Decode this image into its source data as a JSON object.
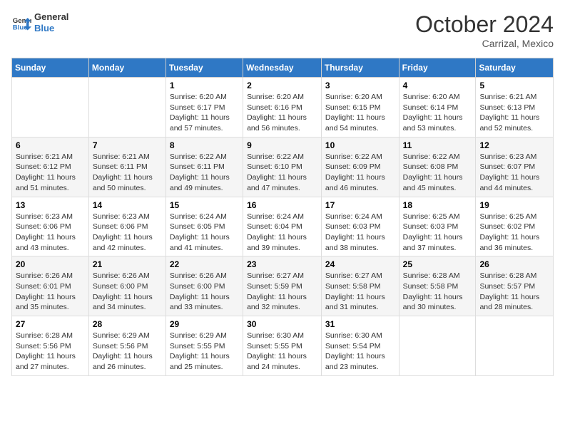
{
  "logo": {
    "line1": "General",
    "line2": "Blue"
  },
  "title": "October 2024",
  "location": "Carrizal, Mexico",
  "days_header": [
    "Sunday",
    "Monday",
    "Tuesday",
    "Wednesday",
    "Thursday",
    "Friday",
    "Saturday"
  ],
  "weeks": [
    [
      {
        "num": "",
        "text": ""
      },
      {
        "num": "",
        "text": ""
      },
      {
        "num": "1",
        "text": "Sunrise: 6:20 AM\nSunset: 6:17 PM\nDaylight: 11 hours and 57 minutes."
      },
      {
        "num": "2",
        "text": "Sunrise: 6:20 AM\nSunset: 6:16 PM\nDaylight: 11 hours and 56 minutes."
      },
      {
        "num": "3",
        "text": "Sunrise: 6:20 AM\nSunset: 6:15 PM\nDaylight: 11 hours and 54 minutes."
      },
      {
        "num": "4",
        "text": "Sunrise: 6:20 AM\nSunset: 6:14 PM\nDaylight: 11 hours and 53 minutes."
      },
      {
        "num": "5",
        "text": "Sunrise: 6:21 AM\nSunset: 6:13 PM\nDaylight: 11 hours and 52 minutes."
      }
    ],
    [
      {
        "num": "6",
        "text": "Sunrise: 6:21 AM\nSunset: 6:12 PM\nDaylight: 11 hours and 51 minutes."
      },
      {
        "num": "7",
        "text": "Sunrise: 6:21 AM\nSunset: 6:11 PM\nDaylight: 11 hours and 50 minutes."
      },
      {
        "num": "8",
        "text": "Sunrise: 6:22 AM\nSunset: 6:11 PM\nDaylight: 11 hours and 49 minutes."
      },
      {
        "num": "9",
        "text": "Sunrise: 6:22 AM\nSunset: 6:10 PM\nDaylight: 11 hours and 47 minutes."
      },
      {
        "num": "10",
        "text": "Sunrise: 6:22 AM\nSunset: 6:09 PM\nDaylight: 11 hours and 46 minutes."
      },
      {
        "num": "11",
        "text": "Sunrise: 6:22 AM\nSunset: 6:08 PM\nDaylight: 11 hours and 45 minutes."
      },
      {
        "num": "12",
        "text": "Sunrise: 6:23 AM\nSunset: 6:07 PM\nDaylight: 11 hours and 44 minutes."
      }
    ],
    [
      {
        "num": "13",
        "text": "Sunrise: 6:23 AM\nSunset: 6:06 PM\nDaylight: 11 hours and 43 minutes."
      },
      {
        "num": "14",
        "text": "Sunrise: 6:23 AM\nSunset: 6:06 PM\nDaylight: 11 hours and 42 minutes."
      },
      {
        "num": "15",
        "text": "Sunrise: 6:24 AM\nSunset: 6:05 PM\nDaylight: 11 hours and 41 minutes."
      },
      {
        "num": "16",
        "text": "Sunrise: 6:24 AM\nSunset: 6:04 PM\nDaylight: 11 hours and 39 minutes."
      },
      {
        "num": "17",
        "text": "Sunrise: 6:24 AM\nSunset: 6:03 PM\nDaylight: 11 hours and 38 minutes."
      },
      {
        "num": "18",
        "text": "Sunrise: 6:25 AM\nSunset: 6:03 PM\nDaylight: 11 hours and 37 minutes."
      },
      {
        "num": "19",
        "text": "Sunrise: 6:25 AM\nSunset: 6:02 PM\nDaylight: 11 hours and 36 minutes."
      }
    ],
    [
      {
        "num": "20",
        "text": "Sunrise: 6:26 AM\nSunset: 6:01 PM\nDaylight: 11 hours and 35 minutes."
      },
      {
        "num": "21",
        "text": "Sunrise: 6:26 AM\nSunset: 6:00 PM\nDaylight: 11 hours and 34 minutes."
      },
      {
        "num": "22",
        "text": "Sunrise: 6:26 AM\nSunset: 6:00 PM\nDaylight: 11 hours and 33 minutes."
      },
      {
        "num": "23",
        "text": "Sunrise: 6:27 AM\nSunset: 5:59 PM\nDaylight: 11 hours and 32 minutes."
      },
      {
        "num": "24",
        "text": "Sunrise: 6:27 AM\nSunset: 5:58 PM\nDaylight: 11 hours and 31 minutes."
      },
      {
        "num": "25",
        "text": "Sunrise: 6:28 AM\nSunset: 5:58 PM\nDaylight: 11 hours and 30 minutes."
      },
      {
        "num": "26",
        "text": "Sunrise: 6:28 AM\nSunset: 5:57 PM\nDaylight: 11 hours and 28 minutes."
      }
    ],
    [
      {
        "num": "27",
        "text": "Sunrise: 6:28 AM\nSunset: 5:56 PM\nDaylight: 11 hours and 27 minutes."
      },
      {
        "num": "28",
        "text": "Sunrise: 6:29 AM\nSunset: 5:56 PM\nDaylight: 11 hours and 26 minutes."
      },
      {
        "num": "29",
        "text": "Sunrise: 6:29 AM\nSunset: 5:55 PM\nDaylight: 11 hours and 25 minutes."
      },
      {
        "num": "30",
        "text": "Sunrise: 6:30 AM\nSunset: 5:55 PM\nDaylight: 11 hours and 24 minutes."
      },
      {
        "num": "31",
        "text": "Sunrise: 6:30 AM\nSunset: 5:54 PM\nDaylight: 11 hours and 23 minutes."
      },
      {
        "num": "",
        "text": ""
      },
      {
        "num": "",
        "text": ""
      }
    ]
  ]
}
